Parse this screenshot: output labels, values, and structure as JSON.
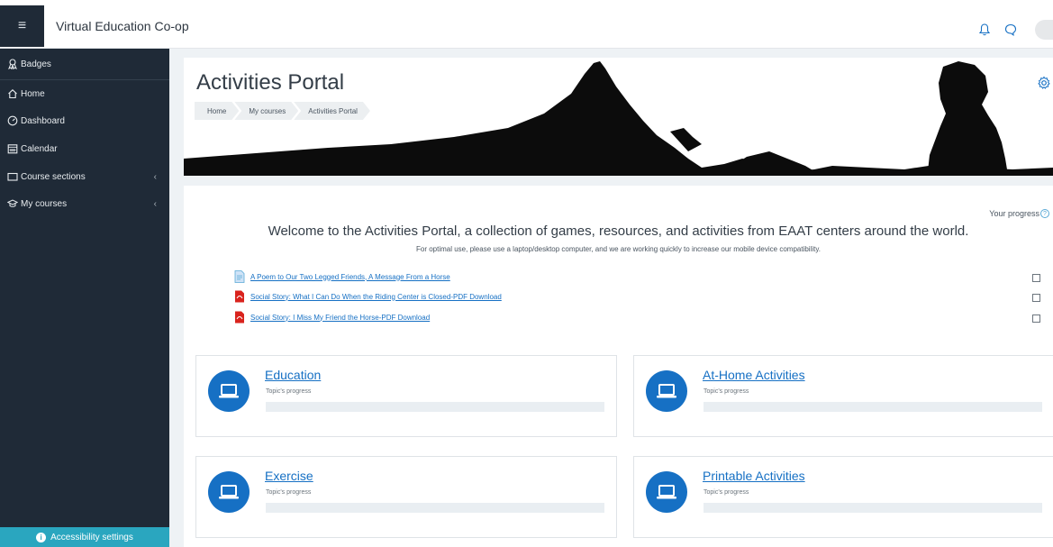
{
  "topbar": {
    "site_name": "Virtual Education Co-op",
    "icons": [
      "menu-icon",
      "bell-icon",
      "chat-icon",
      "avatar"
    ]
  },
  "sidebar": {
    "items": [
      {
        "label": "Badges",
        "icon": "badge-icon"
      },
      {
        "label": "Home",
        "icon": "home-icon"
      },
      {
        "label": "Dashboard",
        "icon": "dashboard-icon"
      },
      {
        "label": "Calendar",
        "icon": "calendar-icon"
      },
      {
        "label": "Course sections",
        "icon": "folder-icon",
        "chevron": "‹"
      },
      {
        "label": "My courses",
        "icon": "graduation-cap-icon",
        "chevron": "‹"
      }
    ],
    "accessibility_label": "Accessibility settings"
  },
  "header": {
    "title": "Activities Portal",
    "breadcrumb": [
      "Home",
      "My courses",
      "Activities Portal"
    ]
  },
  "main": {
    "progress_label": "Your progress",
    "welcome": "Welcome to the Activities Portal, a collection of games, resources, and activities from EAAT centers around the world.",
    "subnote": "For optimal use, please use a laptop/desktop computer, and we are working quickly to increase our mobile device compatibility.",
    "activities": [
      {
        "label": "A Poem to Our Two Legged Friends, A Message From a Horse",
        "icon": "page-icon"
      },
      {
        "label": "Social Story: What I Can Do When the Riding Center is Closed-PDF Download",
        "icon": "pdf-icon"
      },
      {
        "label": "Social Story: I Miss My Friend the Horse-PDF Download",
        "icon": "pdf-icon"
      }
    ],
    "topics": [
      {
        "title": "Education",
        "progress_label": "Topic's progress"
      },
      {
        "title": "At-Home Activities",
        "progress_label": "Topic's progress"
      },
      {
        "title": "Exercise",
        "progress_label": "Topic's progress"
      },
      {
        "title": "Printable Activities",
        "progress_label": "Topic's progress"
      }
    ]
  },
  "colors": {
    "sidebar_bg": "#1f2a37",
    "accent": "#1670c4",
    "accessibility_bg": "#2aa6bf",
    "page_bg": "#eef2f5"
  }
}
